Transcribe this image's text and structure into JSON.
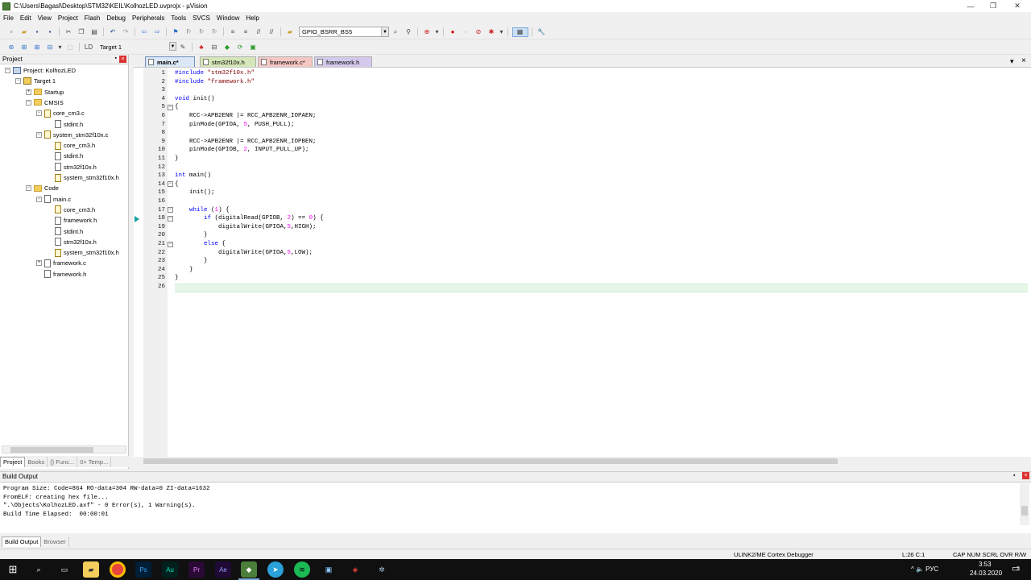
{
  "window": {
    "title": "C:\\Users\\Bagasl\\Desktop\\STM32\\KEIL\\KolhozLED.uvprojx - µVision",
    "controls": [
      "—",
      "❐",
      "✕"
    ]
  },
  "menu": [
    "File",
    "Edit",
    "View",
    "Project",
    "Flash",
    "Debug",
    "Peripherals",
    "Tools",
    "SVCS",
    "Window",
    "Help"
  ],
  "toolbar": {
    "find_combo_value": "GPIO_BSRR_BS5",
    "target_combo_value": "Target 1"
  },
  "project_panel": {
    "title": "Project",
    "pin": "▪",
    "close": "×",
    "tree": [
      {
        "label": "Project: KolhozLED",
        "level": 0,
        "icon": "project",
        "exp": "−"
      },
      {
        "label": "Target 1",
        "level": 1,
        "icon": "target",
        "exp": "−"
      },
      {
        "label": "Startup",
        "level": 2,
        "icon": "folder",
        "exp": "+"
      },
      {
        "label": "CMSIS",
        "level": 2,
        "icon": "folder",
        "exp": "−"
      },
      {
        "label": "core_cm3.c",
        "level": 3,
        "icon": "file-key",
        "exp": "−"
      },
      {
        "label": "stdint.h",
        "level": 4,
        "icon": "file",
        "exp": ""
      },
      {
        "label": "system_stm32f10x.c",
        "level": 3,
        "icon": "file-key",
        "exp": "−"
      },
      {
        "label": "core_cm3.h",
        "level": 4,
        "icon": "file-key",
        "exp": ""
      },
      {
        "label": "stdint.h",
        "level": 4,
        "icon": "file",
        "exp": ""
      },
      {
        "label": "stm32f10x.h",
        "level": 4,
        "icon": "file",
        "exp": ""
      },
      {
        "label": "system_stm32f10x.h",
        "level": 4,
        "icon": "file-key",
        "exp": ""
      },
      {
        "label": "Code",
        "level": 2,
        "icon": "folder",
        "exp": "−"
      },
      {
        "label": "main.c",
        "level": 3,
        "icon": "file",
        "exp": "−"
      },
      {
        "label": "core_cm3.h",
        "level": 4,
        "icon": "file-key",
        "exp": ""
      },
      {
        "label": "framework.h",
        "level": 4,
        "icon": "file",
        "exp": ""
      },
      {
        "label": "stdint.h",
        "level": 4,
        "icon": "file",
        "exp": ""
      },
      {
        "label": "stm32f10x.h",
        "level": 4,
        "icon": "file",
        "exp": ""
      },
      {
        "label": "system_stm32f10x.h",
        "level": 4,
        "icon": "file-key",
        "exp": ""
      },
      {
        "label": "framework.c",
        "level": 3,
        "icon": "file",
        "exp": "+"
      },
      {
        "label": "framework.h",
        "level": 3,
        "icon": "file",
        "exp": ""
      }
    ],
    "tabs": [
      "Project",
      "Books",
      "{} Func...",
      "0+ Temp..."
    ]
  },
  "editor": {
    "tabs": [
      {
        "label": "main.c*",
        "color": "#c7d8ee",
        "active": true
      },
      {
        "label": "stm32f10x.h",
        "color": "#d5e6b8",
        "active": false
      },
      {
        "label": "framework.c*",
        "color": "#f4c7c3",
        "active": false
      },
      {
        "label": "framework.h",
        "color": "#d4c9ec",
        "active": false
      }
    ],
    "tab_menu": "▾",
    "tab_close": "×",
    "current_line": 26,
    "lines": [
      {
        "n": "1",
        "fold": "",
        "html": "<span class='pp'>#include</span> <span class='str'>\"stm32f10x.h\"</span>"
      },
      {
        "n": "2",
        "fold": "",
        "html": "<span class='pp'>#include</span> <span class='str'>\"framework.h\"</span>"
      },
      {
        "n": "3",
        "fold": "",
        "html": ""
      },
      {
        "n": "4",
        "fold": "",
        "html": "<span class='kw'>void</span> init()"
      },
      {
        "n": "5",
        "fold": "−",
        "html": "{"
      },
      {
        "n": "6",
        "fold": "",
        "html": "    RCC-&gt;APB2ENR |= RCC_APB2ENR_IOPAEN;"
      },
      {
        "n": "7",
        "fold": "",
        "html": "    pinMode(GPIOA, <span class='num'>5</span>, PUSH_PULL);"
      },
      {
        "n": "8",
        "fold": "",
        "html": ""
      },
      {
        "n": "9",
        "fold": "",
        "html": "    RCC-&gt;APB2ENR |= RCC_APB2ENR_IOPBEN;"
      },
      {
        "n": "10",
        "fold": "",
        "html": "    pinMode(GPIOB, <span class='num'>2</span>, INPUT_PULL_UP);"
      },
      {
        "n": "11",
        "fold": "",
        "html": "}"
      },
      {
        "n": "12",
        "fold": "",
        "html": ""
      },
      {
        "n": "13",
        "fold": "",
        "html": "<span class='kw'>int</span> main()"
      },
      {
        "n": "14",
        "fold": "−",
        "html": "{"
      },
      {
        "n": "15",
        "fold": "",
        "html": "    init();"
      },
      {
        "n": "16",
        "fold": "",
        "html": ""
      },
      {
        "n": "17",
        "fold": "−",
        "html": "    <span class='kw'>while</span> (<span class='num'>1</span>) {"
      },
      {
        "n": "18",
        "fold": "−",
        "html": "        <span class='kw'>if</span> (digitalRead(GPIOB, <span class='num'>2</span>) == <span class='num'>0</span>) {"
      },
      {
        "n": "19",
        "fold": "",
        "html": "            digitalWrite(GPIOA,<span class='num'>5</span>,HIGH);"
      },
      {
        "n": "20",
        "fold": "",
        "html": "        }"
      },
      {
        "n": "21",
        "fold": "−",
        "html": "        <span class='kw'>else</span> {"
      },
      {
        "n": "22",
        "fold": "",
        "html": "            digitalWrite(GPIOA,<span class='num'>5</span>,LOW);"
      },
      {
        "n": "23",
        "fold": "",
        "html": "        }"
      },
      {
        "n": "24",
        "fold": "",
        "html": "    }"
      },
      {
        "n": "25",
        "fold": "",
        "html": "}"
      },
      {
        "n": "26",
        "fold": "",
        "html": ""
      }
    ]
  },
  "build_output": {
    "title": "Build Output",
    "lines": [
      "Program Size: Code=864 RO-data=304 RW-data=0 ZI-data=1632",
      "FromELF: creating hex file...",
      "\".\\Objects\\KolhozLED.axf\" - 0 Error(s), 1 Warning(s).",
      "Build Time Elapsed:  00:00:01"
    ],
    "tabs": [
      "Build Output",
      "Browser"
    ]
  },
  "status": {
    "debugger": "ULINK2/ME Cortex Debugger",
    "position": "L:26 C:1",
    "flags": "CAP  NUM  SCRL  OVR  R/W"
  },
  "taskbar": {
    "icons": [
      "windows-start",
      "search",
      "task-view",
      "file-explorer",
      "chrome",
      "photoshop",
      "audition",
      "premiere",
      "after-effects",
      "keil",
      "telegram",
      "spotify",
      "remote-desktop",
      "magnet-app",
      "other-app"
    ],
    "tray": "^  🔈  РУС",
    "time": "3:53",
    "date": "24.03.2020",
    "notifications": "2"
  }
}
